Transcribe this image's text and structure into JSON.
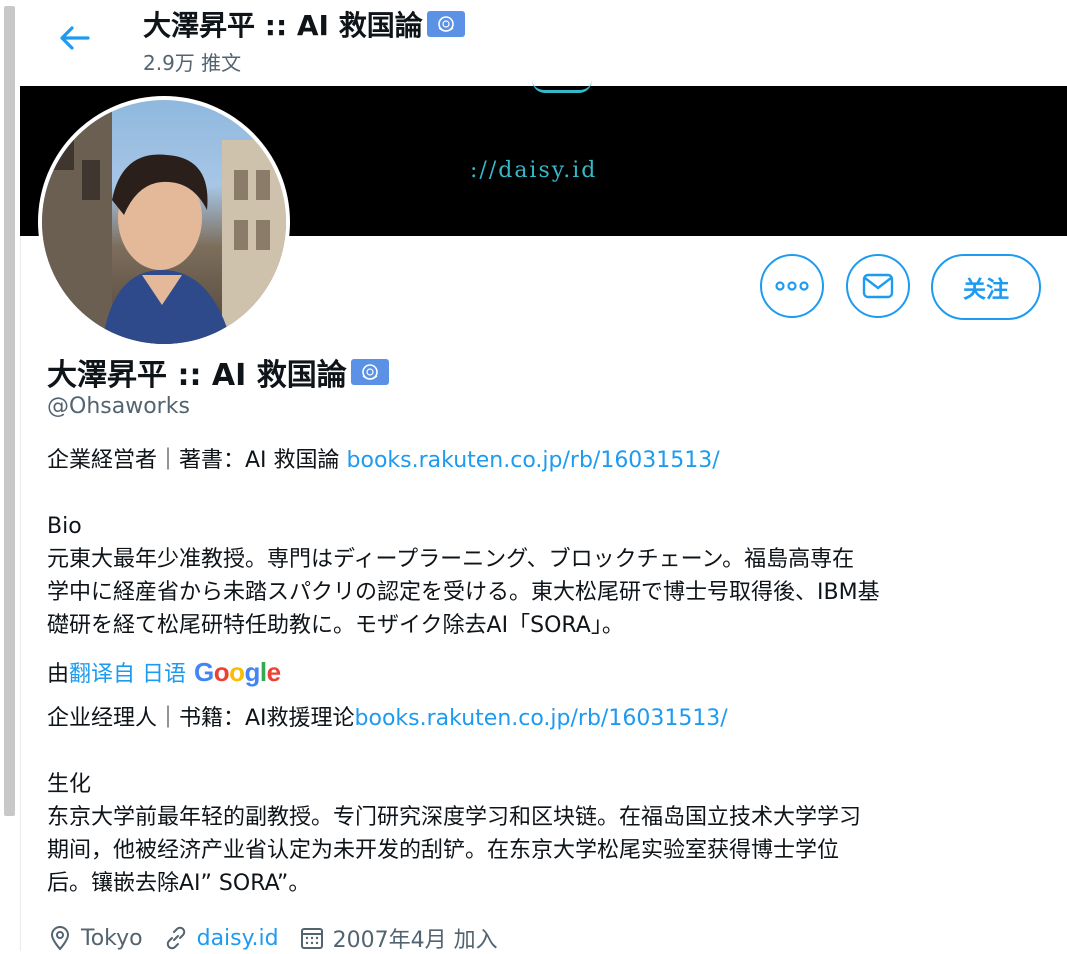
{
  "header": {
    "title": "大澤昇平 :: AI 救国論",
    "tweet_count": "2.9万 推文"
  },
  "banner": {
    "text": "://daisy.id"
  },
  "profile": {
    "name": "大澤昇平 :: AI 救国論",
    "handle": "@Ohsaworks",
    "follow_label": "关注"
  },
  "bio": {
    "line1_text": "企業経営者｜著書：AI 救国論 ",
    "line1_link": "books.rakuten.co.jp/rb/16031513/",
    "section_label": "Bio",
    "body": "元東大最年少准教授。専門はディープラーニング、ブロックチェーン。福島高専在\n学中に経産省から未踏スパクリの認定を受ける。東大松尾研で博士号取得後、IBM基\n礎研を経て松尾研特任助教に。モザイク除去AI「SORA」。"
  },
  "translation": {
    "prefix": "由",
    "link": "翻译自 日语",
    "provider": "Google",
    "line1_text": "企业经理人｜书籍：AI救援理论",
    "line1_link": "books.rakuten.co.jp/rb/16031513/",
    "section_label": "生化",
    "body": "东京大学前最年轻的副教授。专门研究深度学习和区块链。在福岛国立技术大学学习\n期间，他被经济产业省认定为未开发的刮铲。在东京大学松尾实验室获得博士学位\n后。镶嵌去除AI” SORA”。"
  },
  "meta": {
    "location": "Tokyo",
    "website": "daisy.id",
    "joined": "2007年4月 加入"
  },
  "colors": {
    "accent": "#1d9bf0",
    "secondary_text": "#536471",
    "banner_text": "#35b8c7"
  },
  "icons": [
    "back-arrow-icon",
    "un-flag-icon",
    "more-icon",
    "mail-icon",
    "location-icon",
    "link-icon",
    "calendar-icon"
  ]
}
